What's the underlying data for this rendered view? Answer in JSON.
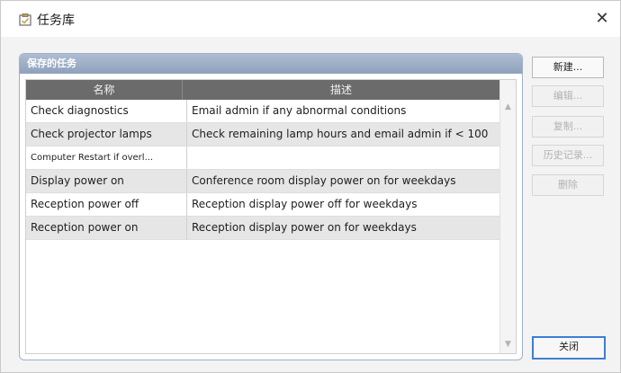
{
  "window": {
    "title": "任务库",
    "close_glyph": "✕"
  },
  "panel": {
    "title": "保存的任务"
  },
  "table": {
    "columns": [
      "名称",
      "描述"
    ],
    "rows": [
      {
        "name": "Check diagnostics",
        "desc": "Email admin if any abnormal conditions"
      },
      {
        "name": "Check projector lamps",
        "desc": "Check remaining lamp hours and email admin if < 100"
      },
      {
        "name": "Computer Restart if overl...",
        "desc": ""
      },
      {
        "name": "Display power on",
        "desc": "Conference room display power on for weekdays"
      },
      {
        "name": "Reception power off",
        "desc": "Reception display power off for weekdays"
      },
      {
        "name": "Reception power on",
        "desc": "Reception display power on for weekdays"
      }
    ]
  },
  "buttons": {
    "new": "新建...",
    "edit": "编辑...",
    "copy": "复制...",
    "history": "历史记录...",
    "delete": "删除",
    "close": "关闭"
  },
  "icons": {
    "app": "task-library-icon",
    "close": "close-icon",
    "scroll_up": "chevron-up-icon",
    "scroll_down": "chevron-down-icon"
  }
}
